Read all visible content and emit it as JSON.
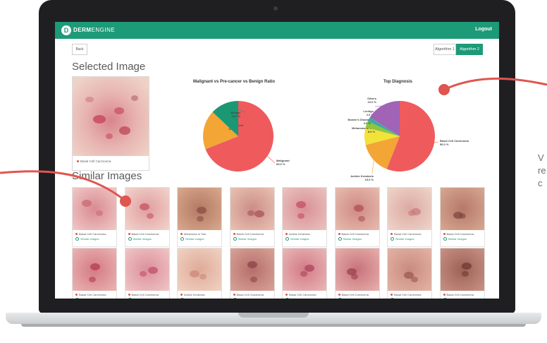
{
  "app": {
    "logo_letter": "D",
    "logo_bold": "DERM",
    "logo_light": "ENGINE",
    "logout_label": "Logout"
  },
  "toolbar": {
    "back_label": "Back",
    "algorithm_1_label": "Algorithm 1",
    "algorithm_2_label": "Algorithm 2",
    "active_algorithm": "Algorithm 2"
  },
  "selected_image": {
    "heading": "Selected Image",
    "diagnosis": "Basal Cell Carcinoma"
  },
  "similar_images": {
    "heading": "Similar Images",
    "link_label": "Similar Images",
    "items": [
      {
        "diagnosis": "Basal Cell Carcinoma"
      },
      {
        "diagnosis": "Basal Cell Carcinoma"
      },
      {
        "diagnosis": "Melanoma In Situ"
      },
      {
        "diagnosis": "Basal Cell Carcinoma"
      },
      {
        "diagnosis": "Actinic Keratosis"
      },
      {
        "diagnosis": "Basal Cell Carcinoma"
      },
      {
        "diagnosis": "Basal Cell Carcinoma"
      },
      {
        "diagnosis": "Basal Cell Carcinoma"
      },
      {
        "diagnosis": "Basal Cell Carcinoma"
      },
      {
        "diagnosis": "Basal Cell Carcinoma"
      },
      {
        "diagnosis": "Actinic Keratosis"
      },
      {
        "diagnosis": "Basal Cell Carcinoma"
      },
      {
        "diagnosis": "Basal Cell Carcinoma"
      },
      {
        "diagnosis": "Basal Cell Carcinoma"
      },
      {
        "diagnosis": "Basal Cell Carcinoma"
      },
      {
        "diagnosis": "Basal Cell Carcinoma"
      }
    ]
  },
  "side_note": {
    "line1": "V",
    "line2": "re",
    "line3": "c"
  },
  "colors": {
    "brand_green": "#1d9a78",
    "pointer_red": "#e0554f"
  },
  "chart_data": [
    {
      "type": "pie",
      "title": "Malignant vs Pre-cancer vs Benign Ratio",
      "slices": [
        {
          "label": "Malignant",
          "display": "69.0 %",
          "value": 69.0,
          "color": "#ef5a5d"
        },
        {
          "label": "Pre-Cancer",
          "display": "18.0 %",
          "value": 18.0,
          "color": "#f3a535"
        },
        {
          "label": "Benign",
          "display": "13.0 %",
          "value": 13.0,
          "color": "#1a9873"
        }
      ]
    },
    {
      "type": "pie",
      "title": "Top Diagnosis",
      "slices": [
        {
          "label": "Basal Cell Carcinoma",
          "display": "56.0 %",
          "value": 56.0,
          "color": "#ef5a5d"
        },
        {
          "label": "Actinic Keratosis",
          "display": "15.0 %",
          "value": 15.0,
          "color": "#f3a535"
        },
        {
          "label": "Melanoma In Situ",
          "display": "8.0 %",
          "value": 8.0,
          "color": "#f2e23a"
        },
        {
          "label": "Bowen&#x27;s Disease",
          "display": "3.0 %",
          "value": 3.0,
          "color": "#8cc63f"
        },
        {
          "label": "Lentigo",
          "display": "2.0 %",
          "value": 2.0,
          "color": "#3fa9a1"
        },
        {
          "label": "Others",
          "display": "16.0 %",
          "value": 16.0,
          "color": "#a163b5"
        }
      ]
    }
  ]
}
